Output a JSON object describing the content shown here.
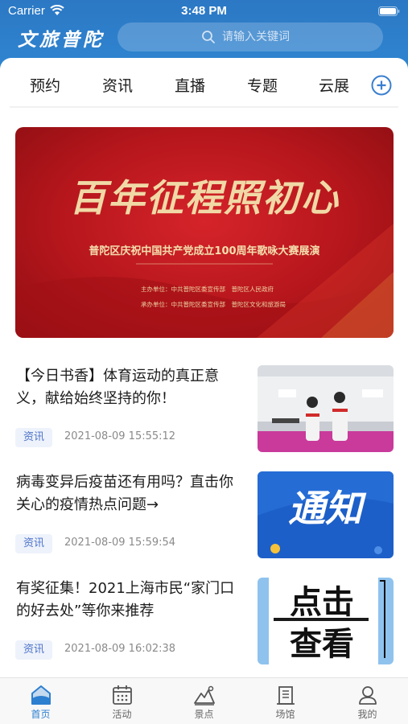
{
  "status_bar": {
    "carrier": "Carrier",
    "time": "3:48 PM"
  },
  "header": {
    "logo_text": "文旅普陀",
    "search_placeholder": "请输入关键词"
  },
  "tabs": [
    {
      "label": "预约"
    },
    {
      "label": "资讯"
    },
    {
      "label": "直播"
    },
    {
      "label": "专题"
    },
    {
      "label": "云展"
    }
  ],
  "banner": {
    "title": "百年征程照初心",
    "subtitle": "普陀区庆祝中国共产党成立100周年歌咏大赛展演",
    "line1": "主办单位：中共普陀区委宣传部　普陀区人民政府",
    "line2": "承办单位：中共普陀区委宣传部　普陀区文化和旅游局"
  },
  "news": [
    {
      "title": "【今日书香】体育运动的真正意义，献给始终坚持的你！",
      "tag": "资讯",
      "time": "2021-08-09 15:55:12"
    },
    {
      "title": "病毒变异后疫苗还有用吗？直击你关心的疫情热点问题→",
      "tag": "资讯",
      "time": "2021-08-09 15:59:54",
      "thumb_text": "通知"
    },
    {
      "title": "有奖征集！2021上海市民“家门口的好去处”等你来推荐",
      "tag": "资讯",
      "time": "2021-08-09 16:02:38",
      "thumb_text_1": "点击",
      "thumb_text_2": "查看"
    }
  ],
  "tabbar": [
    {
      "label": "首页",
      "icon": "home-icon",
      "active": true
    },
    {
      "label": "活动",
      "icon": "calendar-icon"
    },
    {
      "label": "景点",
      "icon": "mountain-icon"
    },
    {
      "label": "场馆",
      "icon": "building-icon"
    },
    {
      "label": "我的",
      "icon": "user-icon"
    }
  ],
  "colors": {
    "header": "#2e80cc",
    "accent": "#2d7fd0",
    "banner": "#c41a20",
    "tag_text": "#4b72c8"
  }
}
